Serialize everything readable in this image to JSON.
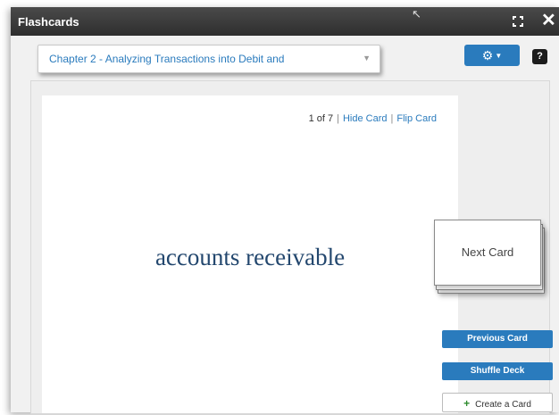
{
  "window": {
    "title": "Flashcards"
  },
  "toolbar": {
    "chapter_select": "Chapter 2 - Analyzing Transactions into Debit and",
    "gear_icon": "gear-icon",
    "help_label": "?"
  },
  "card": {
    "position": "1 of 7",
    "separator": "|",
    "hide_label": "Hide Card",
    "flip_label": "Flip Card",
    "term": "accounts receivable"
  },
  "controls": {
    "next_label": "Next Card",
    "previous_label": "Previous Card",
    "shuffle_label": "Shuffle Deck",
    "create_label": "Create a Card",
    "create_icon": "+"
  },
  "colors": {
    "accent": "#2a7bbd",
    "term_text": "#23476e",
    "titlebar": "#3a3a3a"
  }
}
